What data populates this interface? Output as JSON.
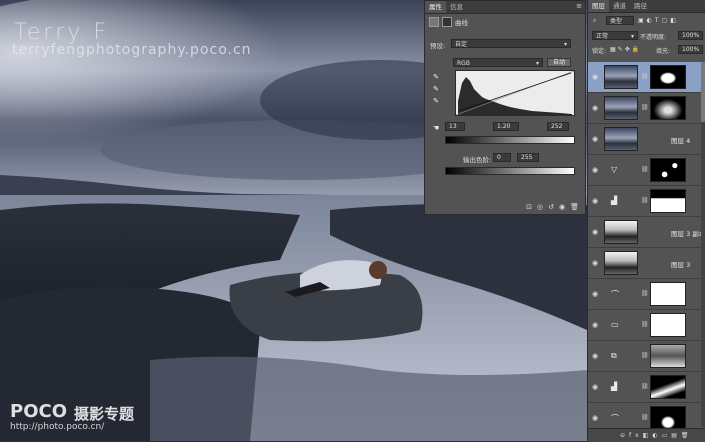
{
  "watermark": {
    "title": "Terry  F",
    "subtitle": "terryfengphotography.poco.cn"
  },
  "site_badge": {
    "logo": "POCO",
    "text": "摄影专题",
    "url": "http://photo.poco.cn/"
  },
  "properties_panel": {
    "tabs": [
      "属性",
      "信息"
    ],
    "active_tab": 0,
    "adjustment_name": "曲线",
    "preset_label": "预设:",
    "preset_value": "自定",
    "channel_value": "RGB",
    "auto_button": "自动",
    "input_black": "13",
    "input_mid": "1.20",
    "input_white": "252",
    "output_label": "输出色阶:",
    "output_black": "0",
    "output_white": "255",
    "menu_icon": "panel-menu-icon"
  },
  "layers_panel": {
    "tabs": [
      "图层",
      "通道",
      "路径"
    ],
    "active_tab": 0,
    "filter_kind": "类型",
    "blend_mode": "正常",
    "opacity_label": "不透明度:",
    "opacity_value": "100%",
    "lock_label": "锁定:",
    "fill_label": "填充:",
    "fill_value": "100%",
    "layers": [
      {
        "name": "",
        "kind": "adjustment",
        "adj_icon": "levels-icon",
        "selected": true,
        "thumb": "sky",
        "mask": "mask-black-white-oval"
      },
      {
        "name": "",
        "kind": "pixel",
        "adj_icon": "",
        "selected": false,
        "thumb": "sky",
        "mask": "mask-black-soft"
      },
      {
        "name": "图层 4",
        "kind": "pixel",
        "adj_icon": "",
        "selected": false,
        "thumb": "sky",
        "mask": ""
      },
      {
        "name": "",
        "kind": "adjustment",
        "adj_icon": "triangle-icon",
        "selected": false,
        "thumb": "",
        "mask": "mask-black-spots"
      },
      {
        "name": "",
        "kind": "adjustment",
        "adj_icon": "levels-icon",
        "selected": false,
        "thumb": "",
        "mask": "mask-white-lower"
      },
      {
        "name": "图层 3 副本",
        "kind": "pixel",
        "adj_icon": "",
        "selected": false,
        "thumb": "bw",
        "mask": ""
      },
      {
        "name": "图层 3",
        "kind": "pixel",
        "adj_icon": "",
        "selected": false,
        "thumb": "bw",
        "mask": ""
      },
      {
        "name": "",
        "kind": "adjustment",
        "adj_icon": "curves-icon",
        "selected": false,
        "thumb": "",
        "mask": "mask-white"
      },
      {
        "name": "",
        "kind": "adjustment",
        "adj_icon": "photo-filter-icon",
        "selected": false,
        "thumb": "",
        "mask": "mask-white"
      },
      {
        "name": "",
        "kind": "adjustment",
        "adj_icon": "channel-mixer-icon",
        "selected": false,
        "thumb": "",
        "mask": "mask-grey-scene"
      },
      {
        "name": "",
        "kind": "adjustment",
        "adj_icon": "levels-icon",
        "selected": false,
        "thumb": "",
        "mask": "mask-black-white"
      },
      {
        "name": "",
        "kind": "adjustment",
        "adj_icon": "curves-icon",
        "selected": false,
        "thumb": "",
        "mask": "mask-black-oval"
      }
    ]
  }
}
